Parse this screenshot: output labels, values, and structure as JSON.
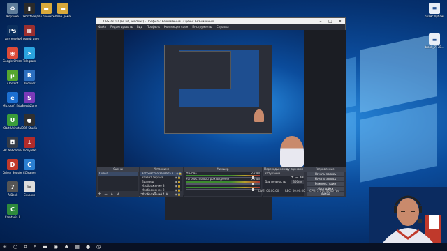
{
  "desktop": {
    "icons_left": [
      {
        "label": "Корзина",
        "icon": "recycle-bin-icon",
        "color": "#5f7d9a",
        "glyph": "♻"
      },
      {
        "label": "Workface",
        "icon": "chart-icon",
        "color": "#2a2a2a",
        "glyph": "▮"
      },
      {
        "label": "для прочитков",
        "icon": "folder-icon",
        "color": "#d9a93b",
        "glyph": "▬"
      },
      {
        "label": "план дома",
        "icon": "folder-icon",
        "color": "#d9a93b",
        "glyph": "▬"
      },
      {
        "label": "для клубы",
        "icon": "photoshop-icon",
        "color": "#0b2f5e",
        "glyph": "Ps"
      },
      {
        "label": "Игровой центр",
        "icon": "game-center-icon",
        "color": "#9b2f2f",
        "glyph": "▦"
      },
      {
        "label": "Google Chrome",
        "icon": "chrome-icon",
        "color": "#dd4b39",
        "glyph": "◉"
      },
      {
        "label": "Telegram",
        "icon": "telegram-icon",
        "color": "#2aa3df",
        "glyph": "➤"
      },
      {
        "label": "uTorrent",
        "icon": "utorrent-icon",
        "color": "#55a630",
        "glyph": "µ"
      },
      {
        "label": "RBooker",
        "icon": "app-icon",
        "color": "#2d6fbf",
        "glyph": "R"
      },
      {
        "label": "Microsoft Edge",
        "icon": "edge-icon",
        "color": "#1c6fd1",
        "glyph": "e"
      },
      {
        "label": "SpyshZone",
        "icon": "app-icon",
        "color": "#7a3ab8",
        "glyph": "S"
      },
      {
        "label": "IObit Uninstaller",
        "icon": "uninstaller-icon",
        "color": "#3a9d3a",
        "glyph": "U"
      },
      {
        "label": "OBS Studio",
        "icon": "obs-icon",
        "color": "#303030",
        "glyph": "●"
      },
      {
        "label": "HP Webcam HD 2300 Lt",
        "icon": "webcam-icon",
        "color": "#333b49",
        "glyph": "◘"
      },
      {
        "label": "UnonyNWT",
        "icon": "app-icon",
        "color": "#b02b2b",
        "glyph": "↓"
      },
      {
        "label": "Driver Booster 6",
        "icon": "driver-booster-icon",
        "color": "#c0392b",
        "glyph": "D"
      },
      {
        "label": "CCleaner",
        "icon": "ccleaner-icon",
        "color": "#2b7fd1",
        "glyph": "C"
      },
      {
        "label": "7zDesk",
        "icon": "archive-icon",
        "color": "#555",
        "glyph": "7"
      },
      {
        "label": "Снимки",
        "icon": "snipping-icon",
        "color": "#dddddd",
        "glyph": "✂"
      },
      {
        "label": "Camtasia 9",
        "icon": "camtasia-icon",
        "color": "#2e8a3c",
        "glyph": "C"
      }
    ],
    "icons_right": [
      {
        "label": "прайс публичный",
        "icon": "document-icon",
        "color": "#e8eef6",
        "glyph": "≡"
      },
      {
        "label": "blank_7778...",
        "icon": "document-icon",
        "color": "#e8eef6",
        "glyph": "≡"
      }
    ]
  },
  "obs": {
    "title": "OBS 23.0.2 (64 bit, windows) - Профиль: Безымянный - Сцены: Безымянный",
    "menu": [
      "Файл",
      "Редактировать",
      "Вид",
      "Профиль",
      "Коллекция сцен",
      "Инструменты",
      "Справка"
    ],
    "scenes": {
      "header": "Сцены",
      "items": [
        "Сцена"
      ]
    },
    "sources": {
      "header": "Источники",
      "items": [
        "Устройство захвата в...",
        "Захват экрана",
        "Браузер",
        "Изображение 3",
        "Изображение 2",
        "Изображение 4"
      ]
    },
    "mixer": {
      "header": "Микшер",
      "channels": [
        {
          "name": "Mic/Aux",
          "db": "0.0 dB"
        },
        {
          "name": "Устройство воспроизведения",
          "db": "0.0 dB"
        },
        {
          "name": "Устройство захвата",
          "db": "0.0 dB"
        }
      ]
    },
    "transitions": {
      "header": "Переходы между сценами",
      "type": "Затухание",
      "duration_label": "Длительность",
      "duration_value": "300ms"
    },
    "controls": {
      "header": "Управление",
      "buttons": [
        "Начать запись",
        "Начать запись",
        "Режим студии",
        "Настройки",
        "Выход"
      ]
    },
    "status": {
      "live": "LIVE: 00:00:00",
      "rec": "REC: 00:00:00",
      "cpu": "CPU: 5.1%, 30.00 fps"
    }
  },
  "taskbar": {
    "start": "⊞",
    "search": "○",
    "items": [
      "⧉",
      "e",
      "▬",
      "◉",
      "♠",
      "▦",
      "●",
      "◷"
    ]
  }
}
